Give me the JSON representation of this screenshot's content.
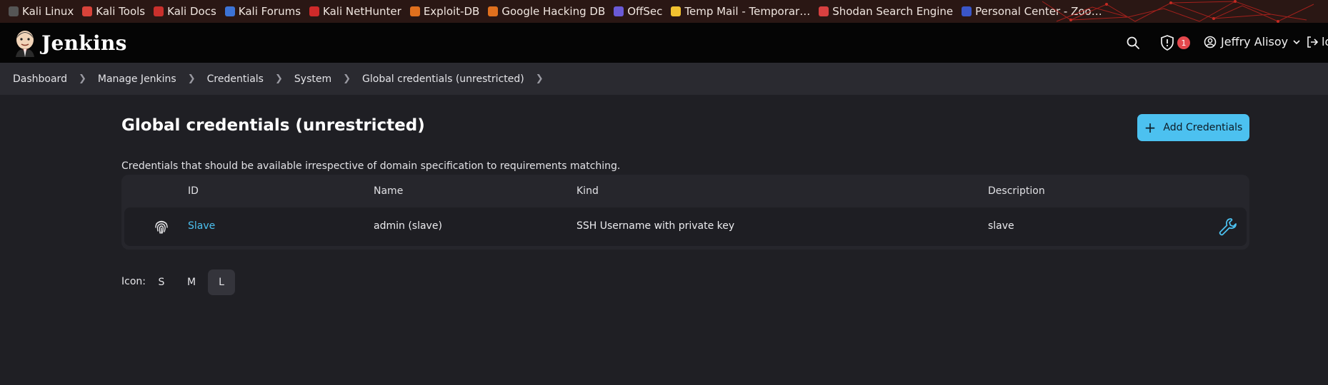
{
  "bookmarks": [
    {
      "label": "Kali Linux",
      "icon": "kali-dragon-icon",
      "color": "#6b6b6b"
    },
    {
      "label": "Kali Tools",
      "icon": "kali-tools-icon",
      "color": "#d8433a"
    },
    {
      "label": "Kali Docs",
      "icon": "kali-docs-icon",
      "color": "#c9302c"
    },
    {
      "label": "Kali Forums",
      "icon": "kali-forums-icon",
      "color": "#3c73d6"
    },
    {
      "label": "Kali NetHunter",
      "icon": "nethunter-icon",
      "color": "#d02a2a"
    },
    {
      "label": "Exploit-DB",
      "icon": "exploit-db-icon",
      "color": "#e0701e"
    },
    {
      "label": "Google Hacking DB",
      "icon": "ghdb-icon",
      "color": "#e0701e"
    },
    {
      "label": "OffSec",
      "icon": "offsec-icon",
      "color": "#6a5ad6"
    },
    {
      "label": "Temp Mail - Temporar…",
      "icon": "temp-mail-icon",
      "color": "#f2c230"
    },
    {
      "label": "Shodan Search Engine",
      "icon": "shodan-icon",
      "color": "#d84040"
    },
    {
      "label": "Personal Center - Zoo…",
      "icon": "zoomeye-icon",
      "color": "#3a56c8"
    }
  ],
  "header": {
    "brand": "Jenkins",
    "notification_count": "1",
    "user_name": "Jeffry Alisoy",
    "logout_partial": "lo"
  },
  "breadcrumbs": [
    "Dashboard",
    "Manage Jenkins",
    "Credentials",
    "System",
    "Global credentials (unrestricted)"
  ],
  "page": {
    "title": "Global credentials (unrestricted)",
    "add_button": "Add Credentials",
    "description": "Credentials that should be available irrespective of domain specification to requirements matching."
  },
  "table": {
    "columns": [
      "ID",
      "Name",
      "Kind",
      "Description"
    ],
    "rows": [
      {
        "id": "Slave",
        "name": "admin (slave)",
        "kind": "SSH Username with private key",
        "description": "slave",
        "icon": "fingerprint-icon",
        "action_icon": "wrench-icon"
      }
    ]
  },
  "icon_size": {
    "label": "Icon:",
    "options": [
      "S",
      "M",
      "L"
    ],
    "selected": "L"
  },
  "colors": {
    "accent": "#4cc1f0",
    "badge": "#e5484d"
  }
}
